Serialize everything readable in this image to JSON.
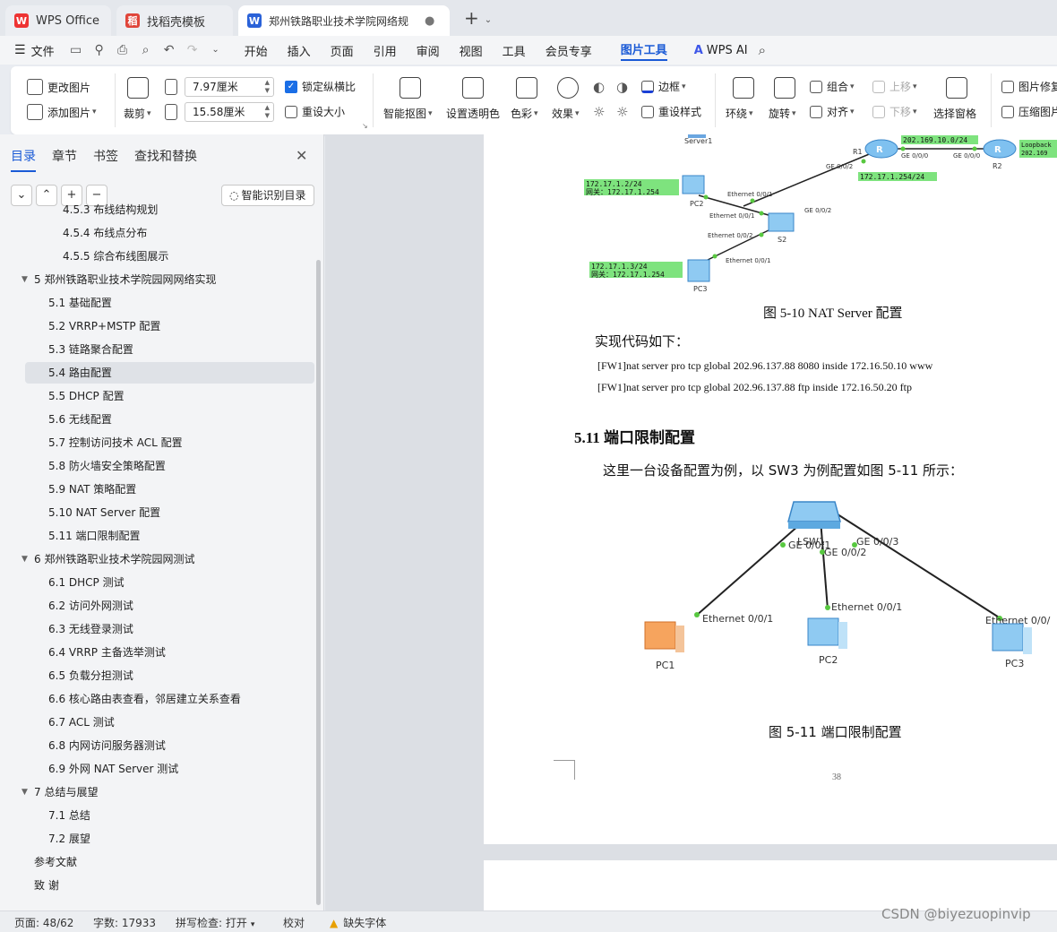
{
  "tabs": [
    {
      "label": "WPS Office"
    },
    {
      "label": "找稻壳模板"
    },
    {
      "label": "郑州铁路职业技术学院网络规"
    }
  ],
  "menu": {
    "file": "文件",
    "items": [
      "开始",
      "插入",
      "页面",
      "引用",
      "审阅",
      "视图",
      "工具",
      "会员专享"
    ],
    "active": "图片工具",
    "ai": "WPS AI"
  },
  "ribbon": {
    "change_image": "更改图片",
    "add_image": "添加图片",
    "crop": "裁剪",
    "width": "7.97厘米",
    "height": "15.58厘米",
    "lock_ratio": "锁定纵横比",
    "reset_size": "重设大小",
    "smart_cutout": "智能抠图",
    "transparent": "设置透明色",
    "color": "色彩",
    "effect": "效果",
    "border": "边框",
    "reset_style": "重设样式",
    "wrap": "环绕",
    "rotate": "旋转",
    "group": "组合",
    "align": "对齐",
    "up": "上移",
    "down": "下移",
    "select_pane": "选择窗格",
    "img_fix": "图片修复",
    "compress": "压缩图片"
  },
  "panel": {
    "tabs": [
      "目录",
      "章节",
      "书签",
      "查找和替换"
    ],
    "smart_toc": "智能识别目录",
    "toc": [
      {
        "label": "4.5.3 布线结构规划",
        "indent": 2
      },
      {
        "label": "4.5.4 布线点分布",
        "indent": 2
      },
      {
        "label": "4.5.5 综合布线图展示",
        "indent": 2
      },
      {
        "label": "5 郑州铁路职业技术学院园网网络实现",
        "indent": 0,
        "expand": true
      },
      {
        "label": "5.1 基础配置",
        "indent": 1
      },
      {
        "label": "5.2 VRRP+MSTP 配置",
        "indent": 1
      },
      {
        "label": "5.3 链路聚合配置",
        "indent": 1
      },
      {
        "label": "5.4 路由配置",
        "indent": 1,
        "selected": true
      },
      {
        "label": "5.5 DHCP 配置",
        "indent": 1
      },
      {
        "label": "5.6 无线配置",
        "indent": 1
      },
      {
        "label": "5.7 控制访问技术 ACL 配置",
        "indent": 1
      },
      {
        "label": "5.8 防火墙安全策略配置",
        "indent": 1
      },
      {
        "label": "5.9 NAT 策略配置",
        "indent": 1
      },
      {
        "label": "5.10 NAT Server 配置",
        "indent": 1
      },
      {
        "label": "5.11 端口限制配置",
        "indent": 1
      },
      {
        "label": "6 郑州铁路职业技术学院园网测试",
        "indent": 0,
        "expand": true
      },
      {
        "label": "6.1 DHCP 测试",
        "indent": 1
      },
      {
        "label": "6.2 访问外网测试",
        "indent": 1
      },
      {
        "label": "6.3 无线登录测试",
        "indent": 1
      },
      {
        "label": "6.4 VRRP 主备选举测试",
        "indent": 1
      },
      {
        "label": "6.5 负载分担测试",
        "indent": 1
      },
      {
        "label": "6.6 核心路由表查看，邻居建立关系查看",
        "indent": 1
      },
      {
        "label": "6.7 ACL 测试",
        "indent": 1
      },
      {
        "label": "6.8 内网访问服务器测试",
        "indent": 1
      },
      {
        "label": "6.9 外网 NAT Server 测试",
        "indent": 1
      },
      {
        "label": "7 总结与展望",
        "indent": 0,
        "expand": true
      },
      {
        "label": "7.1 总结",
        "indent": 1
      },
      {
        "label": "7.2 展望",
        "indent": 1
      },
      {
        "label": "参考文献",
        "indent": 0
      },
      {
        "label": "致 谢",
        "indent": 0
      }
    ]
  },
  "doc": {
    "fig1": {
      "server": "Server1",
      "r1": "R1",
      "r2": "R2",
      "s2": "S2",
      "pc2": "PC2",
      "pc3": "PC3",
      "net_top": "202.169.10.0/24",
      "loopback": "Loopback",
      "loopback_ip": "202.169",
      "ge000_a": "GE 0/0/0",
      "ge000_b": "GE 0/0/0",
      "ge002_r1": "GE 0/0/2",
      "net_mid": "172.17.1.254/24",
      "ge002_s2": "GE 0/0/2",
      "eth001_pc2": "Ethernet 0/0/1",
      "eth001_s2": "Ethernet 0/0/1",
      "eth002_s2": "Ethernet 0/0/2",
      "eth001_pc3": "Ethernet 0/0/1",
      "pc2_ip": "172.17.1.2/24",
      "pc2_gw": "网关：172.17.1.254",
      "pc3_ip": "172.17.1.3/24",
      "pc3_gw": "网关：172.17.1.254"
    },
    "caption1": "图 5-10 NAT Server 配置",
    "code_intro": "实现代码如下：",
    "code1": "[FW1]nat server pro tcp global 202.96.137.88 8080 inside 172.16.50.10 www",
    "code2": "[FW1]nat server pro tcp global 202.96.137.88 ftp inside 172.16.50.20 ftp",
    "heading": "5.11 端口限制配置",
    "para": "这里一台设备配置为例，以 SW3 为例配置如图 5-11 所示：",
    "fig2": {
      "lsw": "LSW1",
      "ge1": "GE 0/0/1",
      "ge2": "GE 0/0/2",
      "ge3": "GE 0/0/3",
      "eth_pc1": "Ethernet 0/0/1",
      "eth_pc2": "Ethernet 0/0/1",
      "eth_pc3": "Ethernet 0/0/",
      "pc1": "PC1",
      "pc2": "PC2",
      "pc3": "PC3"
    },
    "caption2": "图 5-11 端口限制配置",
    "page_number": "38"
  },
  "status": {
    "page": "页面: 48/62",
    "words": "字数: 17933",
    "spell": "拼写检查: 打开",
    "proof": "校对",
    "missing_font": "缺失字体",
    "watermark": "CSDN @biyezuopinvip"
  },
  "colors": {
    "accent": "#1a5ad6",
    "label_green": "#7ee37e",
    "link_green": "#58c840"
  }
}
